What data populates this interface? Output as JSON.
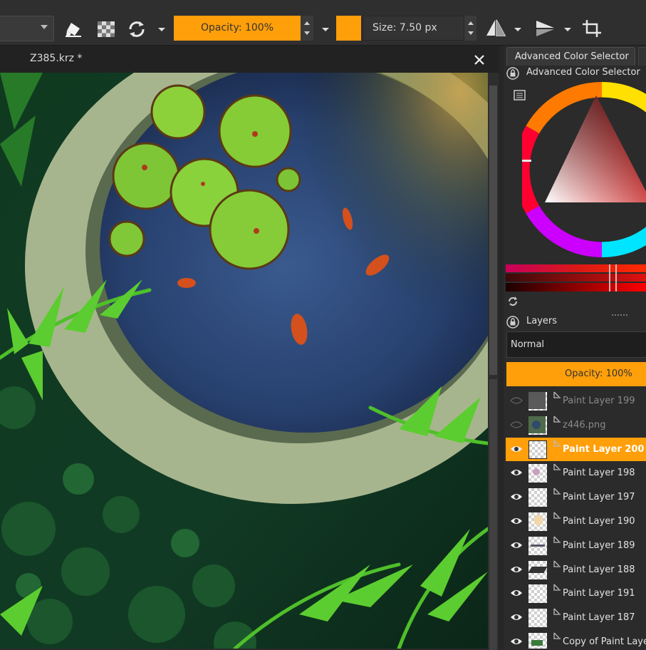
{
  "toolbar": {
    "opacity_label": "Opacity: 100%",
    "size_label": "Size: 7.50 px",
    "accent_color": "#ff9f0a",
    "icons": [
      "chevron-down-icon",
      "eraser-icon",
      "alpha-lock-icon",
      "reload-icon",
      "triangle-down-icon",
      "mirror-horizontal-icon",
      "mirror-vertical-icon",
      "crop-icon"
    ]
  },
  "document": {
    "title": "Z385.krz *"
  },
  "color_panel": {
    "tab_label": "Advanced Color Selector",
    "title": "Advanced Color Selector",
    "current_hue_color": "#ff0000"
  },
  "layers_panel": {
    "title": "Layers",
    "blend_mode": "Normal",
    "opacity_label": "Opacity:  100%",
    "layers": [
      {
        "name": "Paint Layer 199",
        "visible": false,
        "selected": false
      },
      {
        "name": "z446.png",
        "visible": false,
        "selected": false
      },
      {
        "name": "Paint Layer 200",
        "visible": true,
        "selected": true
      },
      {
        "name": "Paint Layer 198",
        "visible": true,
        "selected": false
      },
      {
        "name": "Paint Layer 197",
        "visible": true,
        "selected": false
      },
      {
        "name": "Paint Layer 190",
        "visible": true,
        "selected": false
      },
      {
        "name": "Paint Layer 189",
        "visible": true,
        "selected": false
      },
      {
        "name": "Paint Layer 188",
        "visible": true,
        "selected": false
      },
      {
        "name": "Paint Layer 191",
        "visible": true,
        "selected": false
      },
      {
        "name": "Paint Layer 187",
        "visible": true,
        "selected": false
      },
      {
        "name": "Copy of Paint Layer",
        "visible": true,
        "selected": false
      }
    ]
  }
}
